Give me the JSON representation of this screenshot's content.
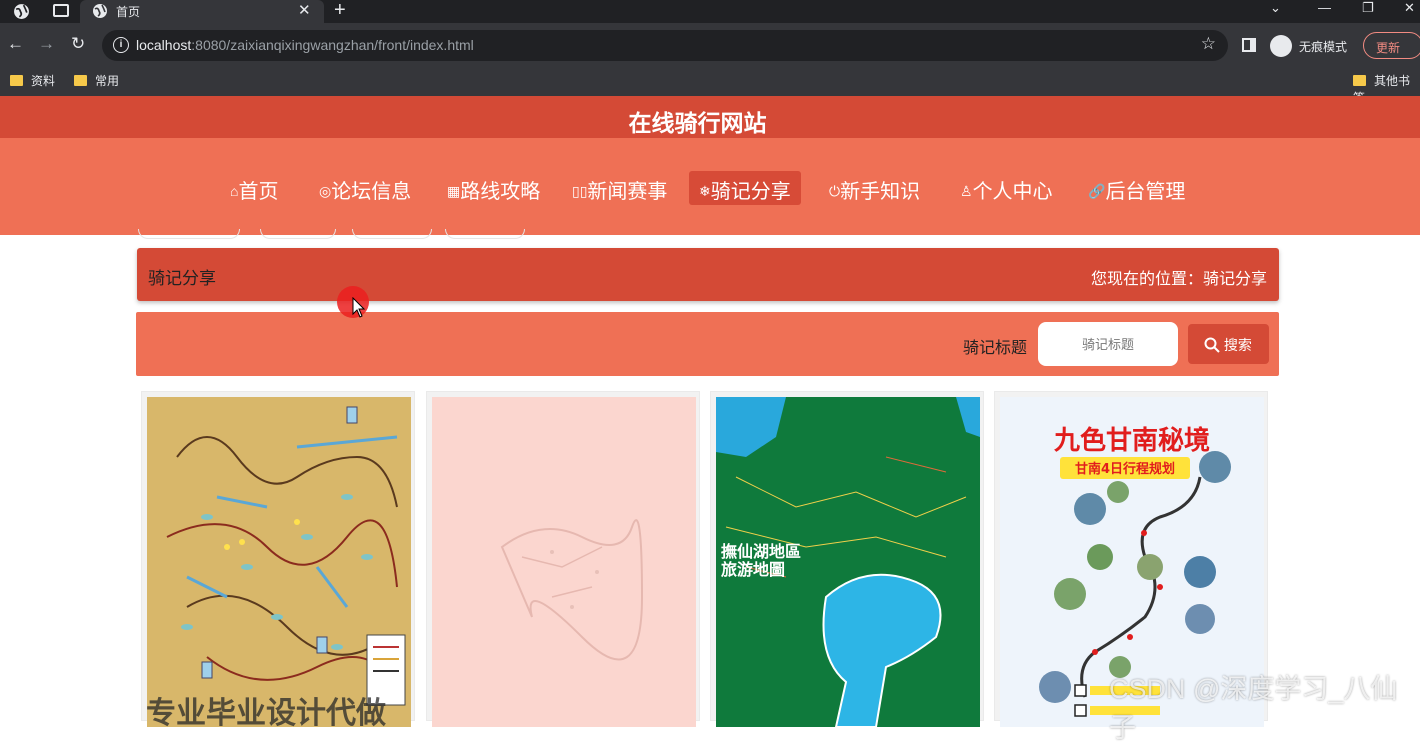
{
  "browser": {
    "tab_title": "首页",
    "url_host": "localhost",
    "url_path": ":8080/zaixianqixingwangzhan/front/index.html",
    "incognito_label": "无痕模式",
    "update_label": "更新",
    "bookmarks": [
      "资料",
      "常用"
    ],
    "other_bookmarks": "其他书签"
  },
  "site": {
    "title": "在线骑行网站",
    "nav": [
      {
        "label": "首页",
        "icon": "home-icon"
      },
      {
        "label": "论坛信息",
        "icon": "compass-icon"
      },
      {
        "label": "路线攻略",
        "icon": "grid-icon"
      },
      {
        "label": "新闻赛事",
        "icon": "columns-icon"
      },
      {
        "label": "骑记分享",
        "icon": "snowflake-icon",
        "active": true
      },
      {
        "label": "新手知识",
        "icon": "power-icon"
      },
      {
        "label": "个人中心",
        "icon": "user-icon"
      },
      {
        "label": "后台管理",
        "icon": "link-icon"
      }
    ]
  },
  "page": {
    "section_title": "骑记分享",
    "location_label": "您现在的位置：骑记分享"
  },
  "search": {
    "label": "骑记标题",
    "placeholder": "骑记标题",
    "button_label": "搜索"
  },
  "cards": [
    {
      "image": "route-map-yellow"
    },
    {
      "image": "route-map-pink-faded"
    },
    {
      "image": "lake-tourist-map"
    },
    {
      "image": "gannan-itinerary-poster"
    }
  ],
  "poster": {
    "lake_map_title_1": "撫仙湖地區",
    "lake_map_title_2": "旅游地圖",
    "gannan_title": "九色甘南秘境",
    "gannan_subtitle": "甘南4日行程规划"
  },
  "overlay": {
    "watermark": "CSDN @深度学习_八仙子",
    "bottom_text": "专业毕业设计代做"
  },
  "colors": {
    "header": "#d44a36",
    "nav": "#ef7055",
    "active": "#d74b37"
  }
}
